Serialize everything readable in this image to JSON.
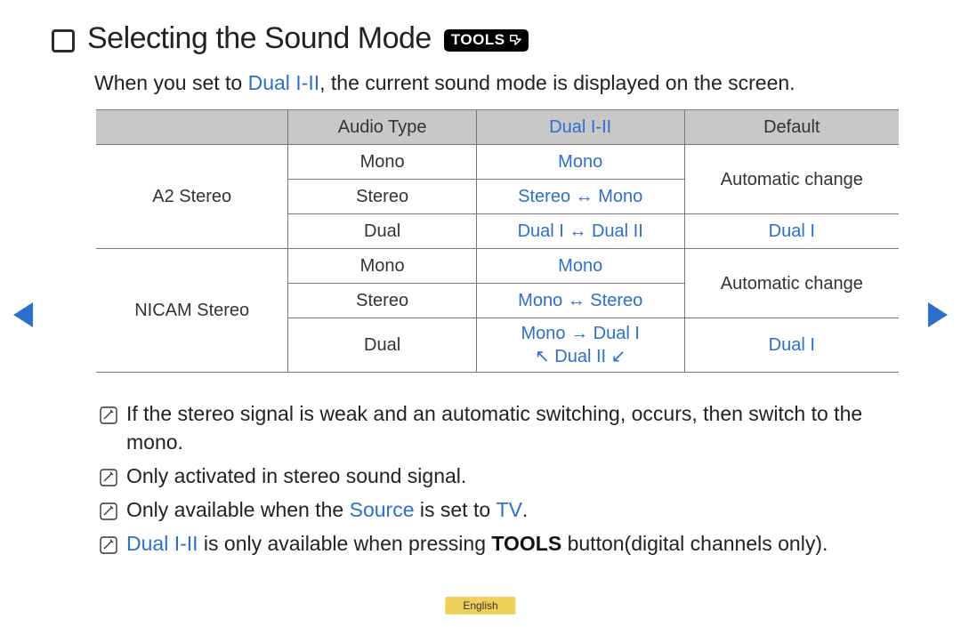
{
  "heading": {
    "title": "Selecting the Sound Mode",
    "tools_label": "TOOLS"
  },
  "intro": {
    "pre": "When you set to ",
    "term": "Dual I-II",
    "post": ", the current sound mode is displayed on the screen."
  },
  "table": {
    "headers": {
      "c1": "",
      "c2": "Audio Type",
      "c3": "Dual I-II",
      "c4": "Default"
    },
    "group1_label": "A2 Stereo",
    "g1r1_audio": "Mono",
    "g1r1_dual": "Mono",
    "g1_default12": "Automatic change",
    "g1r2_audio": "Stereo",
    "g1r2_dual": "Stereo ↔ Mono",
    "g1r3_audio": "Dual",
    "g1r3_dual": "Dual I ↔ Dual II",
    "g1r3_default": "Dual I",
    "group2_label": "NICAM Stereo",
    "g2r1_audio": "Mono",
    "g2r1_dual": "Mono",
    "g2_default12": "Automatic change",
    "g2r2_audio": "Stereo",
    "g2r2_dual": "Mono ↔ Stereo",
    "g2r3_audio": "Dual",
    "g2r3_dual_l1": "Mono → Dual I",
    "g2r3_dual_l2": "↖ Dual II ↙",
    "g2r3_default": "Dual I"
  },
  "notes": {
    "n1": "If the stereo signal is weak and an automatic switching, occurs, then switch to the mono.",
    "n2": "Only activated in stereo sound signal.",
    "n3_pre": "Only available when the ",
    "n3_source": "Source",
    "n3_mid": " is set to ",
    "n3_tv": "TV",
    "n3_post": ".",
    "n4_term": "Dual I-II",
    "n4_mid": " is only available when pressing ",
    "n4_tools": "TOOLS",
    "n4_post": " button(digital channels only)."
  },
  "footer": {
    "language": "English"
  }
}
